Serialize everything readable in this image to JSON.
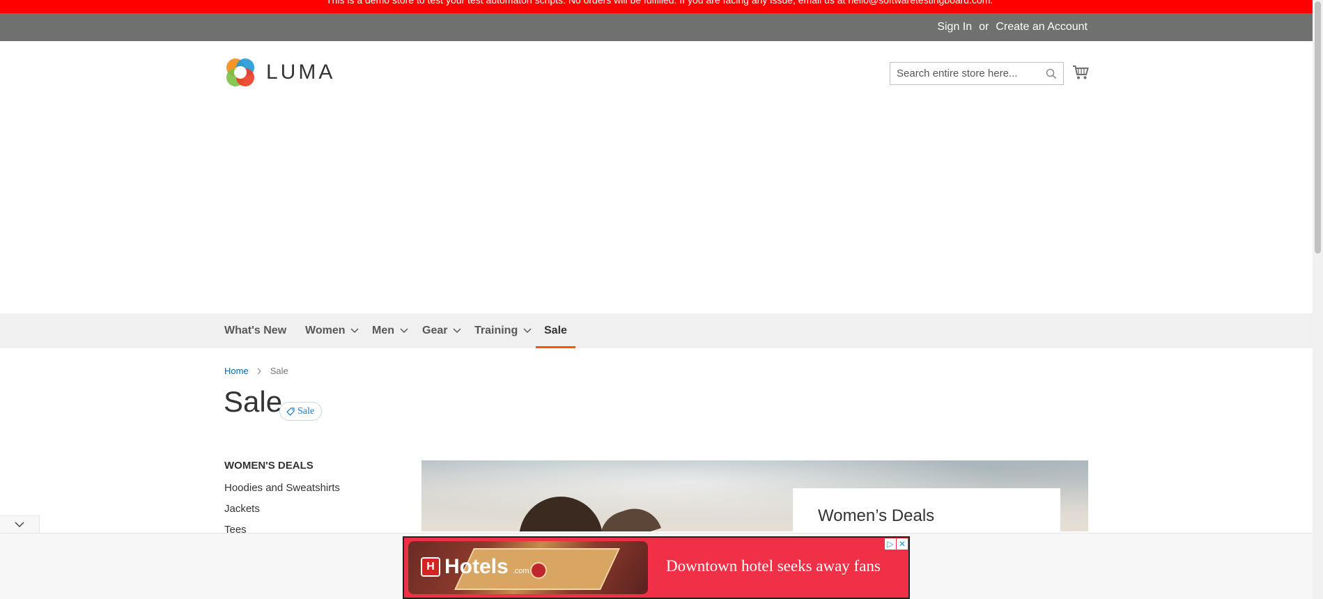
{
  "demo_banner": {
    "text": "This is a demo store to test your test automaton scripts. No orders will be fulfilled. If you are facing any issue, email us at hello@softwaretestingboard.com."
  },
  "top_links": {
    "sign_in": "Sign In",
    "or": "or",
    "create_account": "Create an Account"
  },
  "header": {
    "logo_text": "LUMA",
    "search_placeholder": "Search entire store here...",
    "icons": [
      "search-icon",
      "cart-icon"
    ]
  },
  "nav": {
    "items": [
      {
        "label": "What's New",
        "has_submenu": false
      },
      {
        "label": "Women",
        "has_submenu": true
      },
      {
        "label": "Men",
        "has_submenu": true
      },
      {
        "label": "Gear",
        "has_submenu": true
      },
      {
        "label": "Training",
        "has_submenu": true
      },
      {
        "label": "Sale",
        "has_submenu": false,
        "active": true
      }
    ]
  },
  "breadcrumbs": {
    "home": "Home",
    "current": "Sale"
  },
  "page": {
    "title": "Sale",
    "tag": "Sale"
  },
  "sidebar": {
    "title": "WOMEN'S DEALS",
    "links": [
      "Hoodies and Sweatshirts",
      "Jackets",
      "Tees"
    ]
  },
  "promo": {
    "card_title": "Women’s Deals"
  },
  "ad": {
    "brand": "Hotels",
    "brand_suffix": ".com",
    "headline": "Downtown hotel seeks away fans"
  },
  "colors": {
    "banner": "#ff0000",
    "top_bar": "#6e716e",
    "link": "#006bb4",
    "nav_active_border": "#ff5501",
    "ad_bg": "#ef3046"
  }
}
